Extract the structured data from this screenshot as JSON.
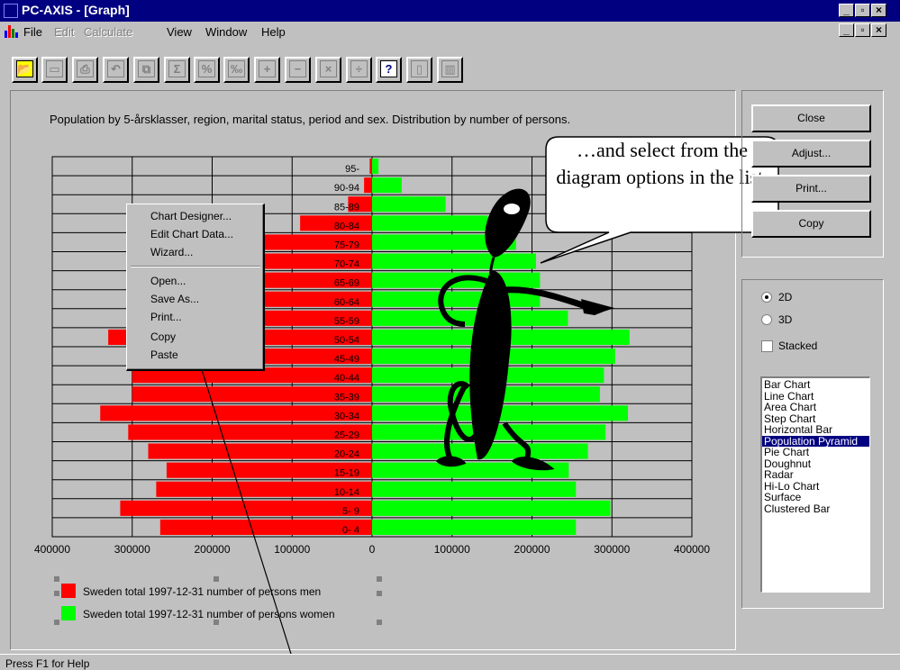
{
  "window": {
    "title": "PC-AXIS - [Graph]",
    "app_icon_text": "PC AXIS"
  },
  "menu": [
    {
      "label": "File",
      "enabled": true
    },
    {
      "label": "Edit",
      "enabled": false
    },
    {
      "label": "Calculate",
      "enabled": false
    },
    {
      "label": "View",
      "enabled": true
    },
    {
      "label": "Window",
      "enabled": true
    },
    {
      "label": "Help",
      "enabled": true
    }
  ],
  "toolbar": [
    {
      "name": "open-icon",
      "glyph": "📂"
    },
    {
      "name": "save-icon",
      "glyph": "▭"
    },
    {
      "name": "print-icon",
      "glyph": "⎙"
    },
    {
      "name": "undo-icon",
      "glyph": "↶"
    },
    {
      "name": "copy-icon",
      "glyph": "⧉"
    },
    {
      "name": "sum-icon",
      "glyph": "Σ"
    },
    {
      "name": "percent-icon",
      "glyph": "%"
    },
    {
      "name": "permille-icon",
      "glyph": "‰"
    },
    {
      "name": "plus-icon",
      "glyph": "+"
    },
    {
      "name": "minus-icon",
      "glyph": "−"
    },
    {
      "name": "multiply-icon",
      "glyph": "×"
    },
    {
      "name": "divide-icon",
      "glyph": "÷"
    },
    {
      "name": "help-icon",
      "glyph": "?"
    },
    {
      "name": "table-icon",
      "glyph": "▯"
    },
    {
      "name": "graph-icon",
      "glyph": "▥"
    }
  ],
  "buttons": {
    "close": "Close",
    "adjust": "Adjust...",
    "print": "Print...",
    "copy": "Copy"
  },
  "options": {
    "radio_2d": "2D",
    "radio_3d": "3D",
    "selected": "2D",
    "stacked_label": "Stacked",
    "stacked_checked": false
  },
  "chart_types": {
    "items": [
      "Bar Chart",
      "Line Chart",
      "Area Chart",
      "Step Chart",
      "Horizontal Bar",
      "Population Pyramid",
      "Pie Chart",
      "Doughnut",
      "Radar",
      "Hi-Lo Chart",
      "Surface",
      "Clustered Bar"
    ],
    "selected": "Population Pyramid"
  },
  "context_menu": {
    "items": [
      "Chart Designer...",
      "Edit Chart Data...",
      "Wizard...",
      "Open...",
      "Save As...",
      "Print...",
      "Copy",
      "Paste"
    ]
  },
  "callout": "…and select from the diagram options in the list.",
  "status": "Press F1 for Help",
  "colors": {
    "men": "#ff0000",
    "women": "#00ff00",
    "title_bar": "#000080",
    "selection": "#000080"
  },
  "chart_data": {
    "type": "bar",
    "orientation": "horizontal",
    "title": "Population by 5-årsklasser, region, marital status, period and sex. Distribution by number of persons.",
    "categories": [
      "95-",
      "90-94",
      "85-89",
      "80-84",
      "75-79",
      "70-74",
      "65-69",
      "60-64",
      "55-59",
      "50-54",
      "45-49",
      "40-44",
      "35-39",
      "30-34",
      "25-29",
      "20-24",
      "15-19",
      "10-14",
      "5- 9",
      "0- 4"
    ],
    "x_ticks": [
      "400000",
      "300000",
      "200000",
      "100000",
      "0",
      "100000",
      "200000",
      "300000",
      "400000"
    ],
    "xlim": [
      -400000,
      400000
    ],
    "grid": true,
    "series": [
      {
        "name": "Sweden total 1997-12-31 number of persons men",
        "values": [
          3000,
          10000,
          30000,
          90000,
          140000,
          180000,
          200000,
          230000,
          250000,
          330000,
          300000,
          300000,
          300000,
          340000,
          305000,
          280000,
          257000,
          270000,
          315000,
          265000
        ]
      },
      {
        "name": "Sweden total 1997-12-31 number of persons women",
        "values": [
          8000,
          37000,
          92000,
          145000,
          180000,
          205000,
          210000,
          210000,
          245000,
          322000,
          304000,
          290000,
          285000,
          320000,
          292000,
          270000,
          246000,
          255000,
          298000,
          255000
        ]
      }
    ],
    "legend_position": "bottom-left"
  }
}
